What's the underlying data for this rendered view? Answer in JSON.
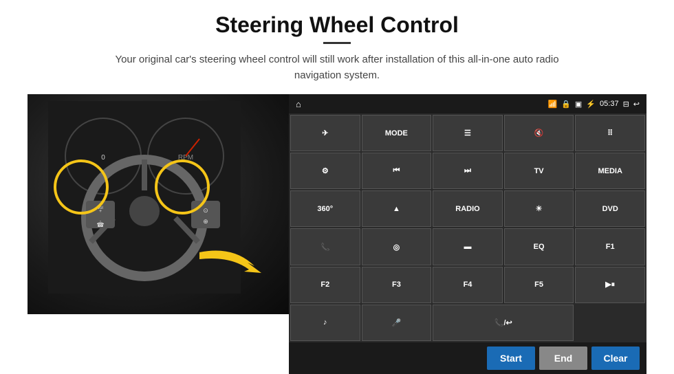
{
  "page": {
    "title": "Steering Wheel Control",
    "subtitle": "Your original car's steering wheel control will still work after installation of this all-in-one auto radio navigation system."
  },
  "status_bar": {
    "home_icon": "⌂",
    "wifi_icon": "📶",
    "lock_icon": "🔒",
    "sd_icon": "💾",
    "bt_icon": "🔷",
    "time": "05:37",
    "screen_icon": "⊟",
    "back_icon": "↩"
  },
  "buttons": [
    {
      "label": "✈",
      "type": "icon"
    },
    {
      "label": "MODE",
      "type": "text"
    },
    {
      "label": "☰",
      "type": "icon"
    },
    {
      "label": "🔇",
      "type": "icon"
    },
    {
      "label": "⠿",
      "type": "icon"
    },
    {
      "label": "⚙",
      "type": "icon"
    },
    {
      "label": "⏮",
      "type": "icon"
    },
    {
      "label": "⏭",
      "type": "icon"
    },
    {
      "label": "TV",
      "type": "text"
    },
    {
      "label": "MEDIA",
      "type": "text"
    },
    {
      "label": "360°",
      "type": "text"
    },
    {
      "label": "▲",
      "type": "icon"
    },
    {
      "label": "RADIO",
      "type": "text"
    },
    {
      "label": "☀",
      "type": "icon"
    },
    {
      "label": "DVD",
      "type": "text"
    },
    {
      "label": "📞",
      "type": "icon"
    },
    {
      "label": "◎",
      "type": "icon"
    },
    {
      "label": "▬",
      "type": "icon"
    },
    {
      "label": "EQ",
      "type": "text"
    },
    {
      "label": "F1",
      "type": "text"
    },
    {
      "label": "F2",
      "type": "text"
    },
    {
      "label": "F3",
      "type": "text"
    },
    {
      "label": "F4",
      "type": "text"
    },
    {
      "label": "F5",
      "type": "text"
    },
    {
      "label": "▶⏸",
      "type": "icon"
    },
    {
      "label": "♪",
      "type": "icon"
    },
    {
      "label": "🎤",
      "type": "icon"
    },
    {
      "label": "📞/↩",
      "type": "icon",
      "wide": true
    }
  ],
  "action_buttons": {
    "start": "Start",
    "end": "End",
    "clear": "Clear"
  }
}
